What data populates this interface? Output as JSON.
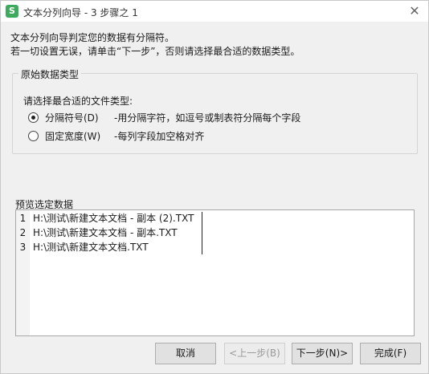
{
  "window": {
    "title": "文本分列向导 - 3 步骤之 1",
    "app_icon_glyph": "S",
    "close_glyph": "✕"
  },
  "description": {
    "line1": "文本分列向导判定您的数据有分隔符。",
    "line2": "若一切设置无误，请单击“下一步”，否则请选择最合适的数据类型。"
  },
  "group": {
    "legend": "原始数据类型",
    "prompt": "请选择最合适的文件类型:",
    "options": [
      {
        "label": "分隔符号(D)",
        "description": "-用分隔字符，如逗号或制表符分隔每个字段",
        "checked": true
      },
      {
        "label": "固定宽度(W)",
        "description": "-每列字段加空格对齐",
        "checked": false
      }
    ]
  },
  "preview": {
    "label": "预览选定数据",
    "rows": [
      {
        "num": "1",
        "text": "H:\\测试\\新建文本文档 - 副本 (2).TXT"
      },
      {
        "num": "2",
        "text": "H:\\测试\\新建文本文档 - 副本.TXT"
      },
      {
        "num": "3",
        "text": "H:\\测试\\新建文本文档.TXT"
      }
    ]
  },
  "buttons": {
    "cancel": "取消",
    "back": "<上一步(B)",
    "next": "下一步(N)>",
    "finish": "完成(F)"
  },
  "colors": {
    "app_icon": "#3daa5e",
    "dialog_bg": "#f0f0f0",
    "button_bg": "#e1e1e1"
  }
}
